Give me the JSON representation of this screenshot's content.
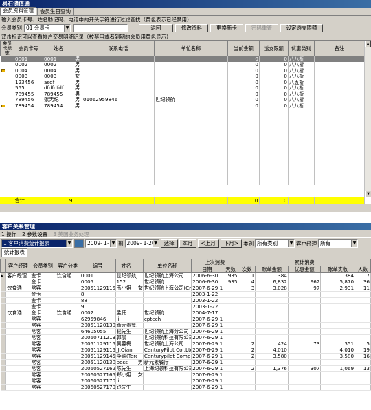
{
  "win1": {
    "title": "易石储值通",
    "tabs": [
      "会员资料管理",
      "会员生日查询"
    ],
    "hint": "输入会员卡号、姓名助记码、电话中的开头字符进行过滤查找（黄色表示已经禁用）",
    "category_label": "会员类别",
    "category_value": "01 会员卡",
    "search_value": "",
    "buttons": [
      "返回",
      "修改资料",
      "更换新卡",
      "密码重置",
      "设定透支限额"
    ],
    "note": "双击标识可以查看帐户交易明细记录（被禁用或者到期的会员用黄色显示）",
    "columns": [
      "会员卡标志",
      "会员卡号",
      "姓名",
      "",
      "联系电话",
      "单位名称",
      "当前余额",
      "透支限额",
      "优惠类别",
      "备注"
    ],
    "rows": [
      {
        "flag": "",
        "card": "0001",
        "name": "0001",
        "sex": "男",
        "phone": "",
        "company": "",
        "bal": "0",
        "limit": "0",
        "disc": "八八折",
        "note": ""
      },
      {
        "flag": "",
        "card": "0002",
        "name": "0002",
        "sex": "男",
        "phone": "",
        "company": "",
        "bal": "0",
        "limit": "0",
        "disc": "八八折",
        "note": ""
      },
      {
        "flag": "key",
        "card": "0004",
        "name": "0004",
        "sex": "男",
        "phone": "",
        "company": "",
        "bal": "0",
        "limit": "0",
        "disc": "八八折",
        "note": ""
      },
      {
        "flag": "",
        "card": "0003",
        "name": "0003",
        "sex": "女",
        "phone": "",
        "company": "",
        "bal": "0",
        "limit": "0",
        "disc": "八八折",
        "note": ""
      },
      {
        "flag": "",
        "card": "123456",
        "name": "asdf",
        "sex": "男",
        "phone": "",
        "company": "",
        "bal": "0",
        "limit": "0",
        "disc": "八五折",
        "note": ""
      },
      {
        "flag": "",
        "card": "555",
        "name": "dfdfdfdf",
        "sex": "男",
        "phone": "",
        "company": "",
        "bal": "0",
        "limit": "0",
        "disc": "八八折",
        "note": ""
      },
      {
        "flag": "",
        "card": "789455",
        "name": "789455",
        "sex": "男",
        "phone": "",
        "company": "",
        "bal": "0",
        "limit": "0",
        "disc": "八八折",
        "note": ""
      },
      {
        "flag": "",
        "card": "789456",
        "name": "张无纪",
        "sex": "男",
        "phone": "01062959846",
        "company": "世纪领航",
        "bal": "0",
        "limit": "0",
        "disc": "八八折",
        "note": ""
      },
      {
        "flag": "key",
        "card": "789454",
        "name": "789454",
        "sex": "男",
        "phone": "",
        "company": "",
        "bal": "0",
        "limit": "0",
        "disc": "八八折",
        "note": ""
      }
    ],
    "total_label": "合计",
    "total_count": "9",
    "total_bal": "0",
    "total_limit": "0"
  },
  "win2": {
    "title": "客户关系管理",
    "menu": [
      "1 操作",
      "2 参数设置",
      "3 美团业务处理"
    ],
    "view_select": "1 客户消费统计报表",
    "date_from": "2009- 1- 1",
    "to_label": "到",
    "date_to": "2009- 1-20",
    "buttons": [
      "选择",
      "本月",
      "<上月",
      "下月>"
    ],
    "category_label": "类别",
    "category_value": "所有类别",
    "manager_label": "客户经理",
    "manager_value": "所有",
    "report_tab": "统计报表",
    "columns": [
      "客户经理",
      "会员类别",
      "客户分类",
      "编号",
      "姓名",
      "",
      "单位名称",
      "日期",
      "天数",
      "次数",
      "账单金额",
      "优惠金额",
      "账单实收",
      "人数"
    ],
    "group_last": "上次消费",
    "group_total": "累计消费",
    "rows": [
      [
        "客户经理",
        "金卡",
        "饮食通",
        "0001",
        "世纪领航_",
        "",
        "世纪领航上海公司",
        "2006-6-30",
        "935",
        "1",
        "384",
        "",
        "384",
        "7"
      ],
      [
        "",
        "金卡",
        "",
        "0005",
        "152",
        "",
        "世纪领航",
        "2006-6-30",
        "935",
        "4",
        "6,832",
        "962",
        "5,870",
        "36"
      ],
      [
        "饮食通",
        "常客",
        "",
        "2005112911525",
        "韦小姐",
        "女",
        "世纪领航上海公司(Cn",
        "2007-6-29 1(",
        "",
        "3",
        "3,028",
        "97",
        "2,931",
        "11"
      ],
      [
        "",
        "金卡",
        "",
        "8",
        "",
        "",
        "",
        "2003-1-22",
        "",
        "",
        "",
        "",
        "",
        ""
      ],
      [
        "",
        "金卡",
        "",
        "88",
        "",
        "",
        "",
        "2003-1-22",
        "",
        "",
        "",
        "",
        "",
        ""
      ],
      [
        "",
        "金卡",
        "",
        "9",
        "",
        "",
        "",
        "2003-1-22",
        "",
        "",
        "",
        "",
        "",
        ""
      ],
      [
        "饮食通",
        "金卡",
        "饮食通",
        "0002",
        "孟伟",
        "",
        "世纪领航",
        "2004-7-17",
        "",
        "",
        "",
        "",
        "",
        ""
      ],
      [
        "",
        "常客",
        "",
        "62959846",
        "li",
        "",
        "cptech",
        "2007-6-29 1(",
        "",
        "",
        "",
        "",
        "",
        ""
      ],
      [
        "",
        "常客",
        "",
        "2005112013015551",
        "新元素餐厅",
        "",
        "",
        "2007-6-29 1(",
        "",
        "",
        "",
        "",
        "",
        ""
      ],
      [
        "",
        "常客",
        "",
        "64605055",
        "钱先生",
        "",
        "世纪领航上海分公司",
        "2007-6-29 1(",
        "",
        "",
        "",
        "",
        "",
        ""
      ],
      [
        "",
        "常客",
        "",
        "2006071121343",
        "郭晨",
        "",
        "世纪领航科技有限公司",
        "2007-6-29 1(",
        "",
        "",
        "",
        "",
        "",
        ""
      ],
      [
        "",
        "常客",
        "",
        "2005112911581",
        "吴蓉梅",
        "",
        "世纪领航上海公司",
        "2007-6-29 1(",
        "",
        "2",
        "424",
        "73",
        "351",
        "5"
      ],
      [
        "",
        "常客",
        "",
        "2005112911593",
        "JJ.Qian",
        "",
        "CenturyPilot Co.,Ltd.",
        "2007-6-29 1(",
        "",
        "2",
        "4,010",
        "",
        "4,010",
        "19"
      ],
      [
        "",
        "常客",
        "",
        "2005112914564",
        "李德(Teres",
        "",
        "Centurypilot Company",
        "2007-6-29 1(",
        "",
        "2",
        "3,580",
        "",
        "3,580",
        "16"
      ],
      [
        "",
        "常客",
        "",
        "2005112013015481",
        "boss",
        "男",
        "新元素餐厅",
        "2007-6-29 1(",
        "",
        "",
        "",
        "",
        "",
        ""
      ],
      [
        "",
        "常客",
        "",
        "2006052716283",
        "陈先生",
        "",
        "上海纪领科技有限公司",
        "2007-6-29 1(",
        "",
        "2",
        "1,376",
        "307",
        "1,069",
        "13"
      ],
      [
        "",
        "常客",
        "",
        "2006052716575",
        "郑小姐",
        "女",
        "",
        "2007-6-29 1(",
        "",
        "",
        "",
        "",
        "",
        ""
      ],
      [
        "",
        "常客",
        "",
        "2006052717005",
        "li",
        "",
        "",
        "2007-6-29 1(",
        "",
        "",
        "",
        "",
        "",
        ""
      ],
      [
        "",
        "常客",
        "",
        "2006052717005",
        "钱先生",
        "",
        "",
        "2007-6-29 1(",
        "",
        "",
        "",
        "",
        "",
        ""
      ]
    ]
  }
}
